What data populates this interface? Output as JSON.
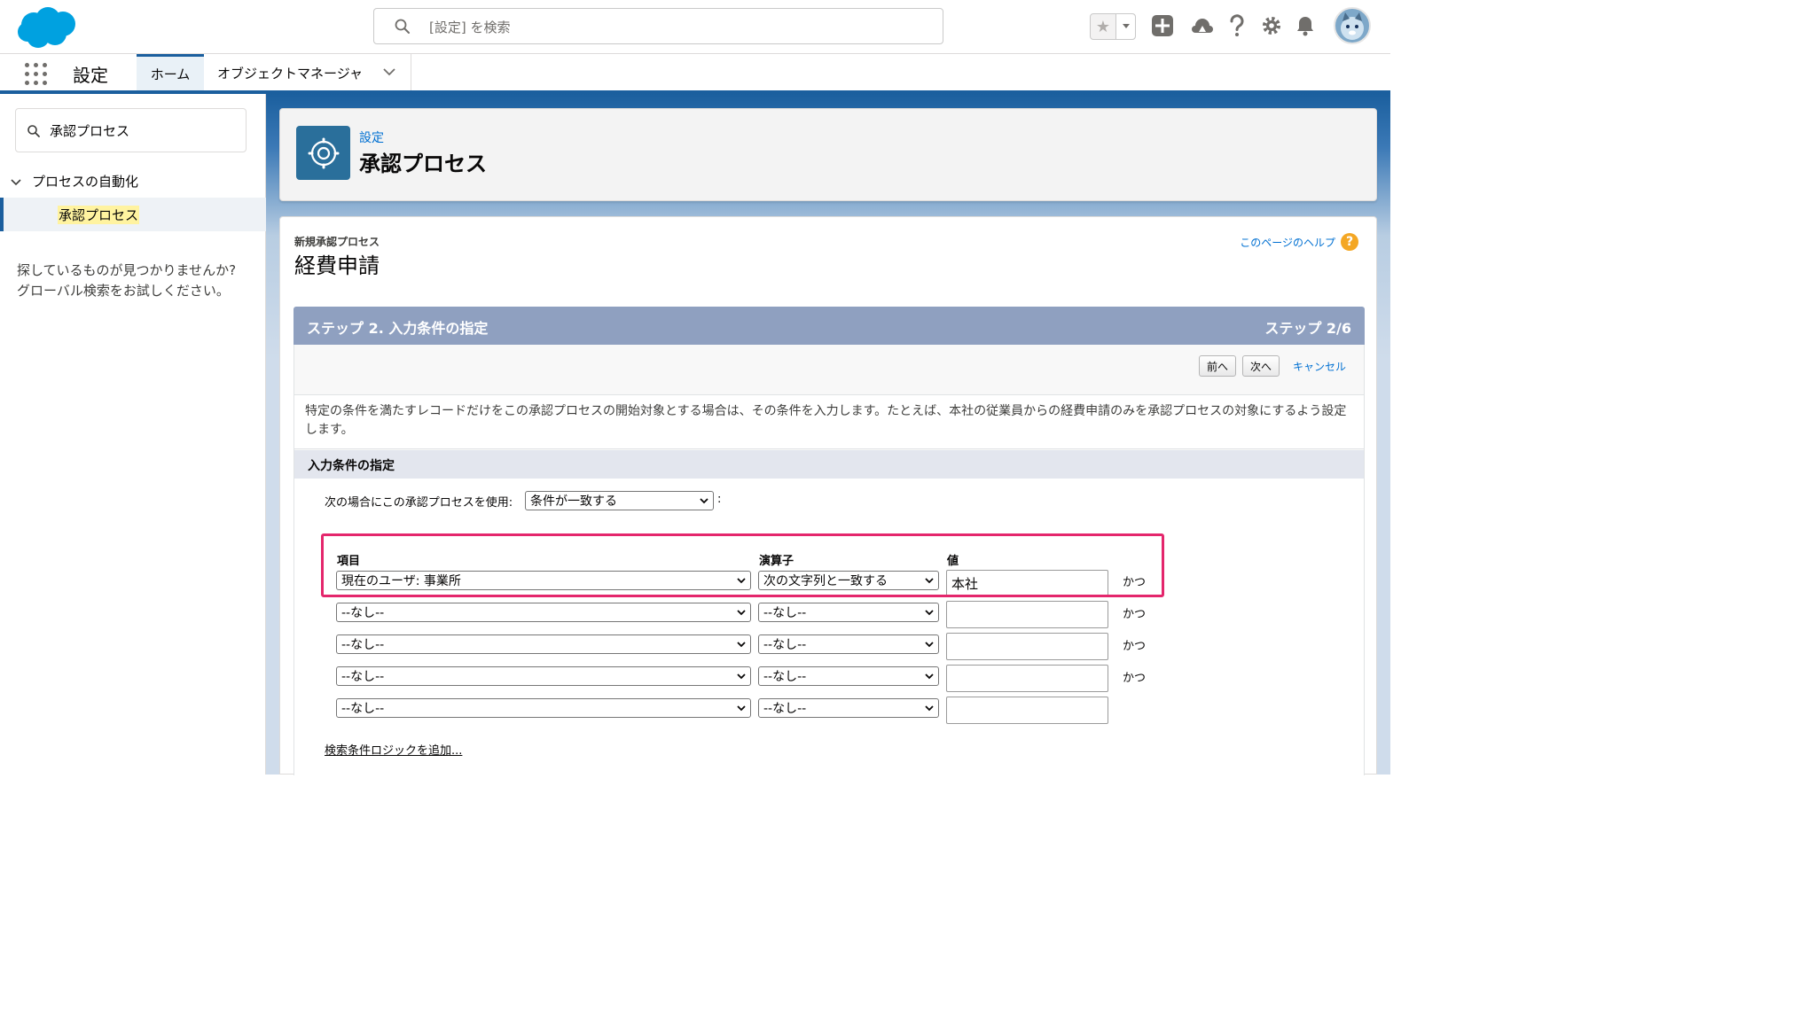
{
  "global_header": {
    "search_placeholder": "[設定] を検索",
    "icons": [
      "salesforce-cloud-logo",
      "favorites-star-icon",
      "chevron-down-icon",
      "global-actions-plus-icon",
      "trailhead-icon",
      "help-icon",
      "gear-icon",
      "notifications-bell-icon",
      "user-avatar"
    ]
  },
  "app_nav": {
    "app_name": "設定",
    "tabs": [
      {
        "label": "ホーム",
        "active": true
      },
      {
        "label": "オブジェクトマネージャ",
        "active": false
      }
    ]
  },
  "sidebar": {
    "search_value": "承認プロセス",
    "group_label": "プロセスの自動化",
    "active_item": "承認プロセス",
    "help_line1": "探しているものが見つかりませんか?",
    "help_line2": "グローバル検索をお試しください。"
  },
  "page_header": {
    "breadcrumb": "設定",
    "title": "承認プロセス"
  },
  "content": {
    "subtitle": "新規承認プロセス",
    "title": "経費申請",
    "help_link": "このページのヘルプ",
    "step_title": "ステップ 2. 入力条件の指定",
    "step_count": "ステップ 2/6",
    "buttons": {
      "prev": "前へ",
      "next": "次へ",
      "cancel": "キャンセル"
    },
    "description": "特定の条件を満たすレコードだけをこの承認プロセスの開始対象とする場合は、その条件を入力します。たとえば、本社の従業員からの経費申請のみを承認プロセスの対象にするよう設定します。",
    "section_title": "入力条件の指定",
    "use_label": "次の場合にこの承認プロセスを使用:",
    "use_select": "条件が一致する",
    "use_colon": ":",
    "columns": {
      "field": "項目",
      "operator": "演算子",
      "value": "値"
    },
    "rows": [
      {
        "field": "現在のユーザ: 事業所",
        "operator": "次の文字列と一致する",
        "value": "本社",
        "conj": "かつ"
      },
      {
        "field": "--なし--",
        "operator": "--なし--",
        "value": "",
        "conj": "かつ"
      },
      {
        "field": "--なし--",
        "operator": "--なし--",
        "value": "",
        "conj": "かつ"
      },
      {
        "field": "--なし--",
        "operator": "--なし--",
        "value": "",
        "conj": "かつ"
      },
      {
        "field": "--なし--",
        "operator": "--なし--",
        "value": "",
        "conj": ""
      }
    ],
    "logic_link": "検索条件ロジックを追加..."
  },
  "colors": {
    "brand_blue": "#1b5f9e",
    "step_bar": "#8fa0c0",
    "highlight_border": "#e4266c",
    "link": "#0070d2"
  }
}
